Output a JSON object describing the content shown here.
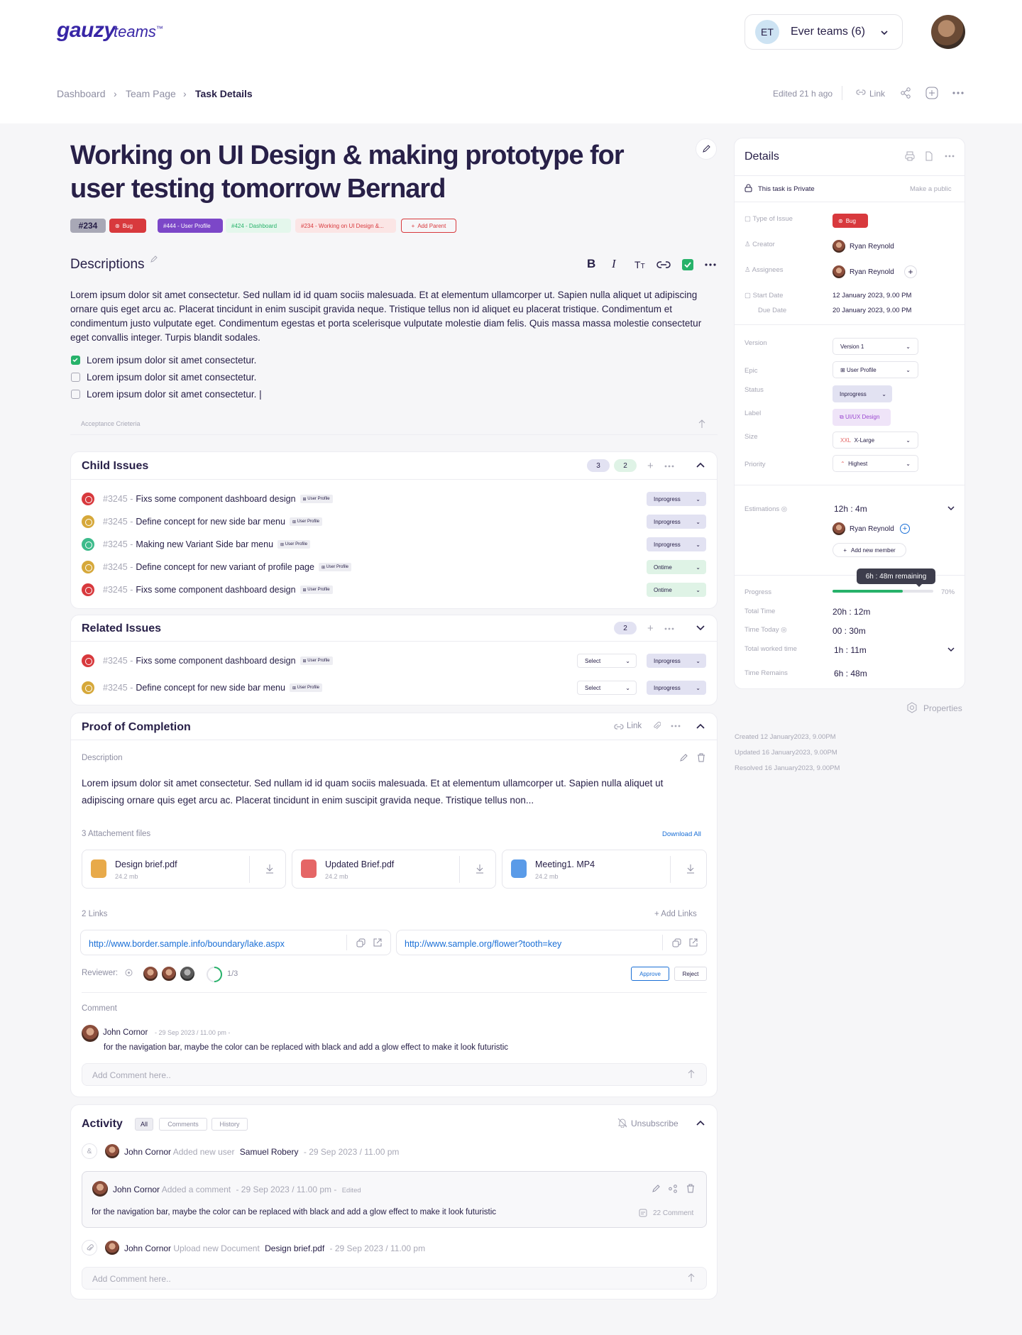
{
  "header": {
    "logo": "gauzy",
    "logo_sub": "teams",
    "logo_tm": "™",
    "team_initials": "ET",
    "team_name": "Ever teams (6)"
  },
  "breadcrumb": {
    "items": [
      "Dashboard",
      "Team Page",
      "Task Details"
    ],
    "edited": "Edited 21 h ago",
    "link_label": "Link"
  },
  "task": {
    "title": "Working on UI Design & making prototype for user testing tomorrow Bernard",
    "number": "#234",
    "tags": [
      {
        "label": "Bug",
        "color": "#d8393d"
      },
      {
        "label": "#444 - User Profile",
        "color": "#7c47c8"
      },
      {
        "label": "#424 - Dashboard",
        "color": "#27b26a"
      },
      {
        "label": "#234 - Working on UI Design &...",
        "color": "#d8393d"
      },
      {
        "label": "Add Parent",
        "color": "#d8393d"
      }
    ]
  },
  "descriptions": {
    "heading": "Descriptions",
    "body": "Lorem ipsum dolor sit amet consectetur. Sed nullam id id quam sociis malesuada. Et at elementum ullamcorper ut. Sapien nulla aliquet ut adipiscing ornare quis eget arcu ac. Placerat tincidunt in enim suscipit gravida neque. Tristique tellus non id aliquet eu placerat tristique. Condimentum et condimentum justo vulputate eget. Condimentum egestas et porta scelerisque vulputate molestie diam felis. Quis massa massa molestie consectetur eget convallis integer. Turpis blandit sodales.",
    "checklist": [
      {
        "label": "Lorem ipsum dolor sit amet consectetur.",
        "checked": true
      },
      {
        "label": "Lorem ipsum dolor sit amet consectetur.",
        "checked": false
      },
      {
        "label": "Lorem ipsum dolor sit amet consectetur.",
        "checked": false
      }
    ],
    "acceptance_placeholder": "Acceptance Crieteria"
  },
  "child_issues": {
    "heading": "Child Issues",
    "count_a": "3",
    "count_b": "2",
    "items": [
      {
        "num": "#3245 -",
        "title": "Fixs some component dashboard design",
        "tag": "User Profile",
        "status": "Inprogress",
        "color": "#d8393d"
      },
      {
        "num": "#3245 -",
        "title": "Define concept for new side bar menu",
        "tag": "User Profile",
        "status": "Inprogress",
        "color": "#d6a83a"
      },
      {
        "num": "#3245 -",
        "title": "Making new Variant Side bar menu",
        "tag": "User Profile",
        "status": "Inprogress",
        "color": "#3dbb8b"
      },
      {
        "num": "#3245 -",
        "title": "Define concept for new variant of profile page",
        "tag": "User Profile",
        "status": "Ontime",
        "color": "#d6a83a"
      },
      {
        "num": "#3245 -",
        "title": "Fixs some component dashboard design",
        "tag": "User Profile",
        "status": "Ontime",
        "color": "#d8393d"
      }
    ]
  },
  "related_issues": {
    "heading": "Related Issues",
    "count": "2",
    "items": [
      {
        "num": "#3245 -",
        "title": "Fixs some component dashboard design",
        "tag": "User Profile",
        "select": "Select",
        "status": "Inprogress",
        "color": "#d8393d"
      },
      {
        "num": "#3245 -",
        "title": "Define concept for new side bar menu",
        "tag": "User Profile",
        "select": "Select",
        "status": "Inprogress",
        "color": "#d6a83a"
      }
    ]
  },
  "proof": {
    "heading": "Proof of Completion",
    "link_label": "Link",
    "desc_label": "Description",
    "desc": "Lorem ipsum dolor sit amet consectetur. Sed nullam id id quam sociis malesuada. Et at elementum ullamcorper ut. Sapien nulla aliquet ut adipiscing ornare quis eget arcu ac. Placerat tincidunt in enim suscipit gravida neque. Tristique tellus non...",
    "attachments_label": "3 Attachement files",
    "download_all": "Download All",
    "files": [
      {
        "name": "Design brief.pdf",
        "size": "24.2 mb",
        "color": "#e8aa4a"
      },
      {
        "name": "Updated Brief.pdf",
        "size": "24.2 mb",
        "color": "#e56666"
      },
      {
        "name": "Meeting1. MP4",
        "size": "24.2 mb",
        "color": "#5a9be8"
      }
    ],
    "links_label": "2 Links",
    "add_links": "Add Links",
    "links": [
      "http://www.border.sample.info/boundary/lake.aspx",
      "http://www.sample.org/flower?tooth=key"
    ],
    "reviewer_label": "Reviewer:",
    "review_progress": "1/3",
    "approve": "Approve",
    "reject": "Reject",
    "comment_label": "Comment",
    "comment_author": "John Cornor",
    "comment_time": "29 Sep 2023 / 11.00 pm",
    "comment_text": "for the navigation bar, maybe the color can be replaced with black and add a glow effect to make it look futuristic",
    "comment_placeholder": "Add Comment here.."
  },
  "activity": {
    "heading": "Activity",
    "tabs": [
      "All",
      "Comments",
      "History"
    ],
    "unsubscribe": "Unsubscribe",
    "items": [
      {
        "author": "John Cornor",
        "action": "Added new user",
        "target": "Samuel Robery",
        "time": "29 Sep 2023 / 11.00 pm"
      },
      {
        "author": "John Cornor",
        "action": "Added a comment",
        "time": "29 Sep 2023 / 11.00 pm",
        "edited": "Edited",
        "text": "for the navigation bar, maybe the color can be replaced with black and add a glow effect to make it look futuristic",
        "comments": "22 Comment"
      },
      {
        "author": "John Cornor",
        "action": "Upload new Document",
        "target": "Design brief.pdf",
        "time": "29 Sep 2023 / 11.00 pm"
      }
    ],
    "comment_placeholder": "Add Comment here.."
  },
  "details": {
    "heading": "Details",
    "private_text": "This task is Private",
    "make_public": "Make a public",
    "type_label": "Type of Issue",
    "type_value": "Bug",
    "creator_label": "Creator",
    "creator": "Ryan Reynold",
    "assignees_label": "Assignees",
    "assignee": "Ryan Reynold",
    "start_label": "Start Date",
    "start": "12 January 2023, 9.00 PM",
    "due_label": "Due Date",
    "due": "20 January 2023, 9.00 PM",
    "version_label": "Version",
    "version": "Version 1",
    "epic_label": "Epic",
    "epic": "User Profile",
    "status_label": "Status",
    "status": "Inprogress",
    "label_label": "Label",
    "label": "UI/UX Design",
    "size_label": "Size",
    "size_code": "XXL",
    "size": "X-Large",
    "priority_label": "Priority",
    "priority": "Highest",
    "estimations_label": "Estimations",
    "estimation": "12h : 4m",
    "est_member": "Ryan Reynold",
    "add_member": "Add new member",
    "tooltip": "6h : 48m remaining",
    "progress_label": "Progress",
    "progress_pct": "70%",
    "progress_value": 0.7,
    "total_time_label": "Total Time",
    "total_time": "20h : 12m",
    "time_today_label": "Time Today",
    "time_today": "00 : 30m",
    "worked_label": "Total worked time",
    "worked": "1h : 11m",
    "remains_label": "Time Remains",
    "remains": "6h : 48m",
    "properties": "Properties",
    "created": "Created 12 January2023, 9.00PM",
    "updated": "Updated 16 January2023, 9.00PM",
    "resolved": "Resolved 16 January2023, 9.00PM"
  }
}
